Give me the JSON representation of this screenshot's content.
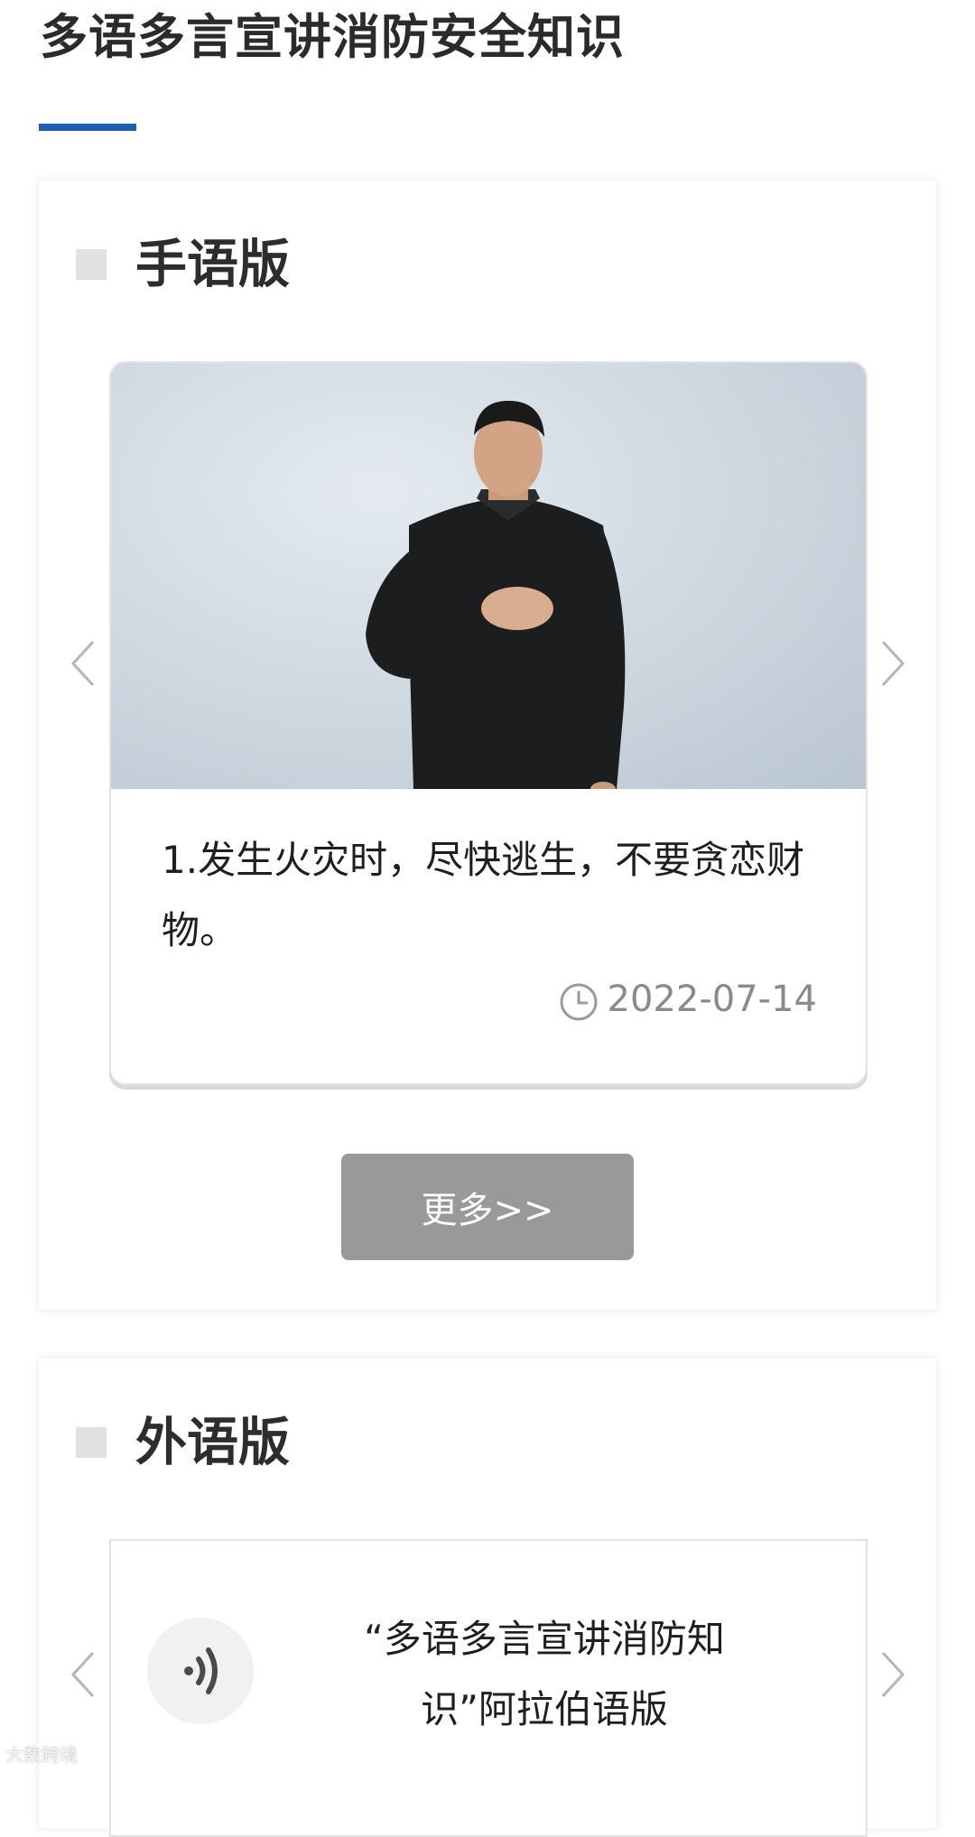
{
  "page": {
    "title": "多语多言宣讲消防安全知识"
  },
  "sections": [
    {
      "title": "手语版",
      "item": {
        "title": "1.发生火灾时，尽快逃生，不要贪恋财物。",
        "date": "2022-07-14"
      },
      "more_label": "更多>>"
    },
    {
      "title": "外语版",
      "item": {
        "title": "“多语多言宣讲消防知识”阿拉伯语版"
      }
    }
  ],
  "watermark": "大数跨境",
  "colors": {
    "accent": "#1d5fb6",
    "more_button": "#999999",
    "section_square": "#e1e1e1"
  },
  "icons": {
    "prev": "chevron-left-icon",
    "next": "chevron-right-icon",
    "date": "clock-icon",
    "audio": "speaker-icon"
  }
}
